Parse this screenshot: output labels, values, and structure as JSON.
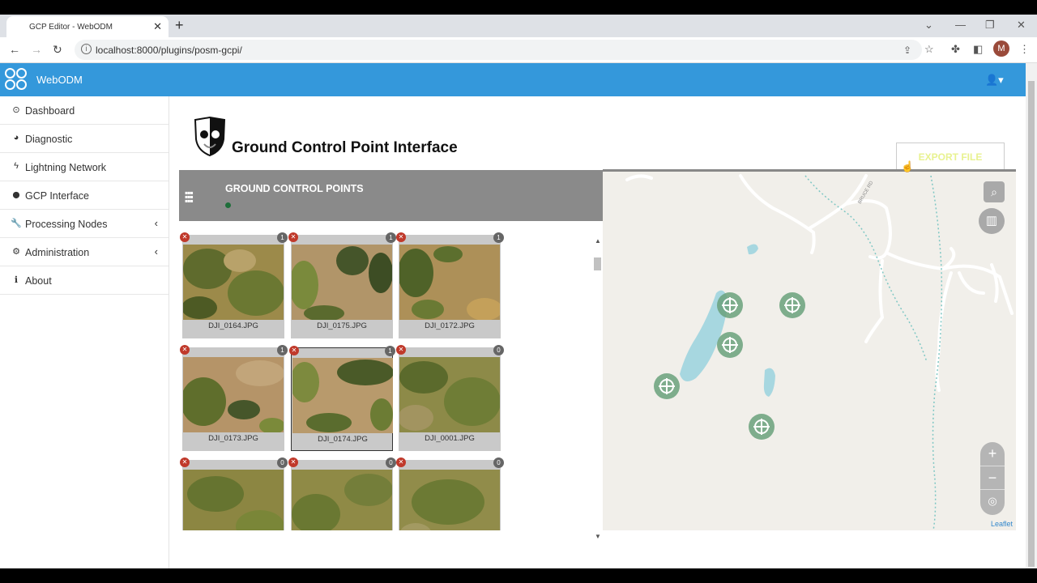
{
  "browser": {
    "tab_title": "GCP Editor - WebODM",
    "tab_close": "✕",
    "new_tab": "+",
    "url": "localhost:8000/plugins/posm-gcpi/",
    "profile_initial": "M"
  },
  "app": {
    "name": "WebODM",
    "user_menu": "👤▾"
  },
  "sidebar": {
    "items": [
      {
        "label": "Dashboard",
        "icon": "⊙"
      },
      {
        "label": "Diagnostic",
        "icon": "◕"
      },
      {
        "label": "Lightning Network",
        "icon": "ϟ"
      },
      {
        "label": "GCP Interface",
        "icon": "⬤"
      },
      {
        "label": "Processing Nodes",
        "icon": "🔧",
        "chevron": "‹"
      },
      {
        "label": "Administration",
        "icon": "⚙",
        "chevron": "‹"
      },
      {
        "label": "About",
        "icon": "ℹ"
      }
    ]
  },
  "page": {
    "title": "Ground Control Point Interface",
    "export_button": "EXPORT FILE"
  },
  "gcp_panel": {
    "title": "GROUND CONTROL POINTS"
  },
  "images": [
    {
      "name": "DJI_0164.JPG",
      "count": "1"
    },
    {
      "name": "DJI_0175.JPG",
      "count": "1"
    },
    {
      "name": "DJI_0172.JPG",
      "count": "1"
    },
    {
      "name": "DJI_0173.JPG",
      "count": "1"
    },
    {
      "name": "DJI_0174.JPG",
      "count": "1"
    },
    {
      "name": "DJI_0001.JPG",
      "count": "0"
    },
    {
      "name": "",
      "count": "0"
    },
    {
      "name": "",
      "count": "0"
    },
    {
      "name": "",
      "count": "0"
    }
  ],
  "map": {
    "zoom_in": "+",
    "zoom_out": "−",
    "attribution": "Leaflet",
    "road_label": "BRUCE RD"
  }
}
